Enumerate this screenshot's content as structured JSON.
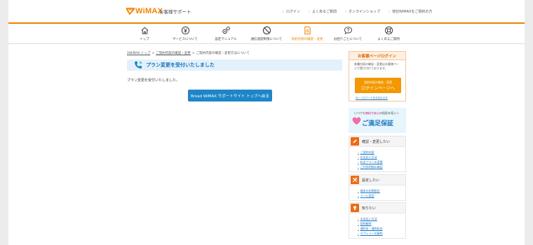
{
  "header": {
    "logo": "WiMAX",
    "site_name": "お客様サポート",
    "links": [
      "ログイン",
      "よくあるご質問",
      "オンラインショップ",
      "他社WiMAXをご契約の方"
    ]
  },
  "nav": {
    "items": [
      {
        "label": "トップ",
        "icon": "home-icon"
      },
      {
        "label": "サービスについて",
        "icon": "yen-icon"
      },
      {
        "label": "設定マニュアル",
        "icon": "gears-icon"
      },
      {
        "label": "通信速度制限について",
        "icon": "prohibited-icon"
      },
      {
        "label": "契約内容の確認・変更",
        "icon": "document-icon"
      },
      {
        "label": "お困りごとについて",
        "icon": "question-bubble-icon"
      },
      {
        "label": "よくあるご質問",
        "icon": "lifebuoy-icon"
      }
    ],
    "active_index": 4
  },
  "breadcrumb": {
    "items": [
      "2WiMAX トップ",
      "ご契約内容の確認・変更",
      "ご契約内容の確認・変更方法について"
    ]
  },
  "main": {
    "title": "プラン変更を受付いたしました",
    "message": "プラン変更を受付いたしました。",
    "back_button": "Broad WiMAX サポートサイト トップへ戻る"
  },
  "sidebar": {
    "login": {
      "title": "お客様ページログイン",
      "description": "各種内容の確認・変更はお客様ページで受け付けております。",
      "button_line1": "契約内容の確認・変更",
      "button_line2": "ログインページへ",
      "forgot": "ID・パスワードをお忘れの方"
    },
    "banner": {
      "top_pre": "いつでも",
      "top_free": "無料",
      "top_mid": "で",
      "top_safe": "安心",
      "top_post": "の保証を導入へ",
      "big": "ご満足保証"
    },
    "menus": [
      {
        "title": "確認・変更したい",
        "items": [
          "ご契約内容",
          "お支払い方法",
          "料金プランの変更",
          "ご利用明細の確認"
        ]
      },
      {
        "title": "設定したい",
        "items": [
          "端末の初期設定",
          "メール設定"
        ]
      },
      {
        "title": "知りたい",
        "items": [
          "お支払い方法",
          "契約解除",
          "違約金・違約料金",
          "オプションの解約"
        ]
      }
    ]
  },
  "colors": {
    "brand_orange": "#f08300",
    "link_blue": "#1e78c2",
    "title_blue": "#1a73b5",
    "button_blue": "#1e86c8"
  }
}
